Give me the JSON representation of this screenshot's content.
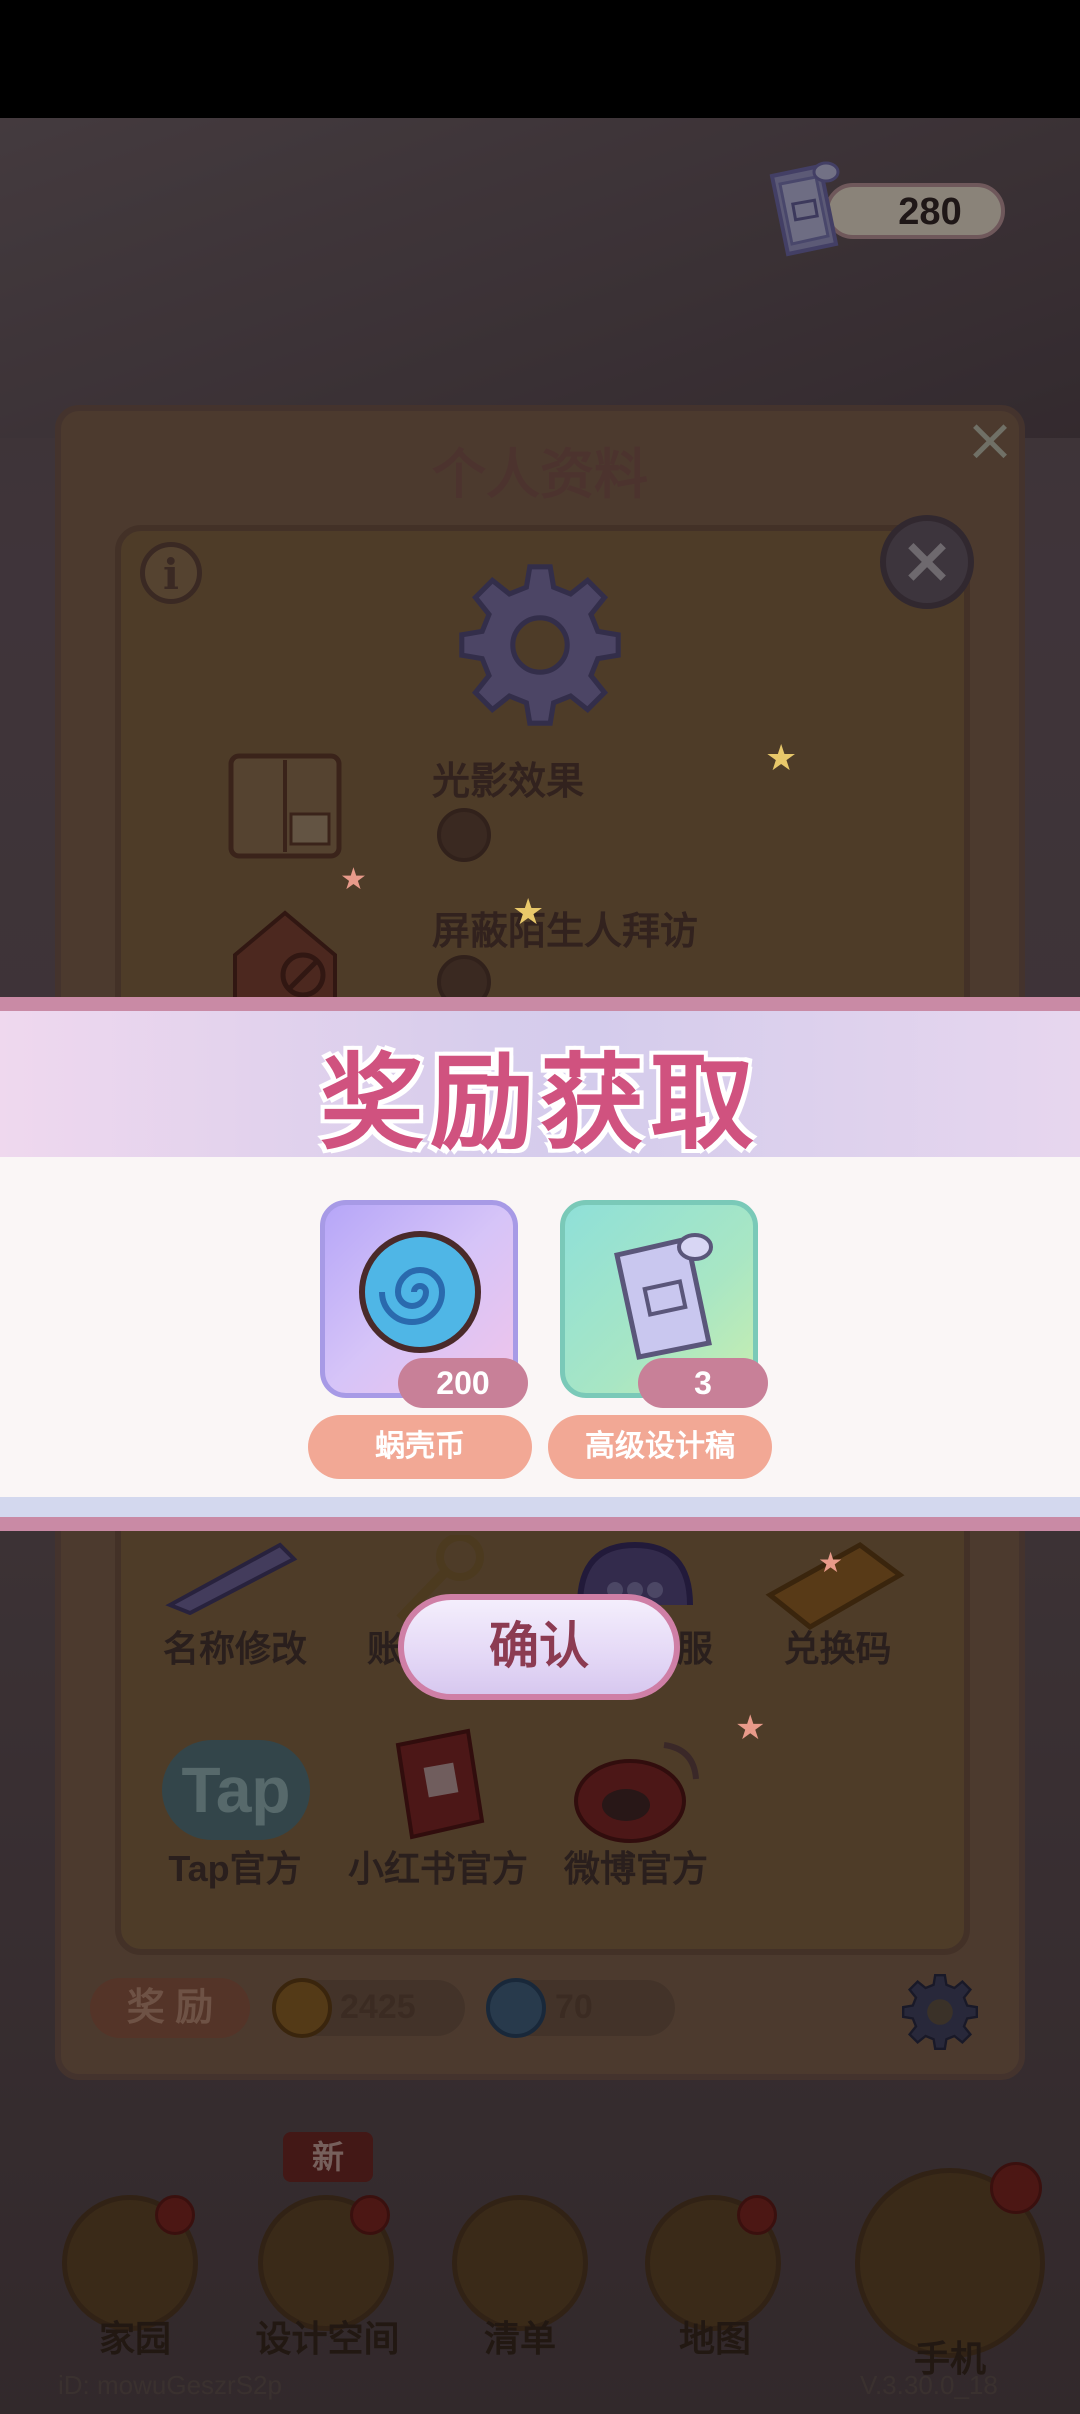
{
  "resource": {
    "value": "280",
    "icon": "blueprint-icon"
  },
  "profile": {
    "title": "个人资料",
    "settings": [
      {
        "label": "光影效果"
      },
      {
        "label": "屏蔽陌生人拜访"
      }
    ],
    "grid_row1": [
      "名称修改",
      "账",
      "服",
      "兑换码"
    ],
    "grid_row2": [
      "Tap官方",
      "小红书官方",
      "微博官方"
    ],
    "tap_logo": "Tap",
    "award_label": "奖 励",
    "currencies": [
      {
        "icon": "coin-icon",
        "value": "2425"
      },
      {
        "icon": "swirl-icon",
        "value": "70"
      }
    ]
  },
  "nav": {
    "items": [
      "家园",
      "设计空间",
      "清单",
      "地图",
      "手机"
    ],
    "new_badge": "新"
  },
  "footer": {
    "id": "iD: mowuGeszrS2p",
    "version": "V.3.30.0_18"
  },
  "reward": {
    "title": "奖励获取",
    "items": [
      {
        "name": "蜗壳币",
        "count": "200",
        "icon": "shell-coin-icon"
      },
      {
        "name": "高级设计稿",
        "count": "3",
        "icon": "blueprint-icon"
      }
    ],
    "confirm": "确认"
  }
}
